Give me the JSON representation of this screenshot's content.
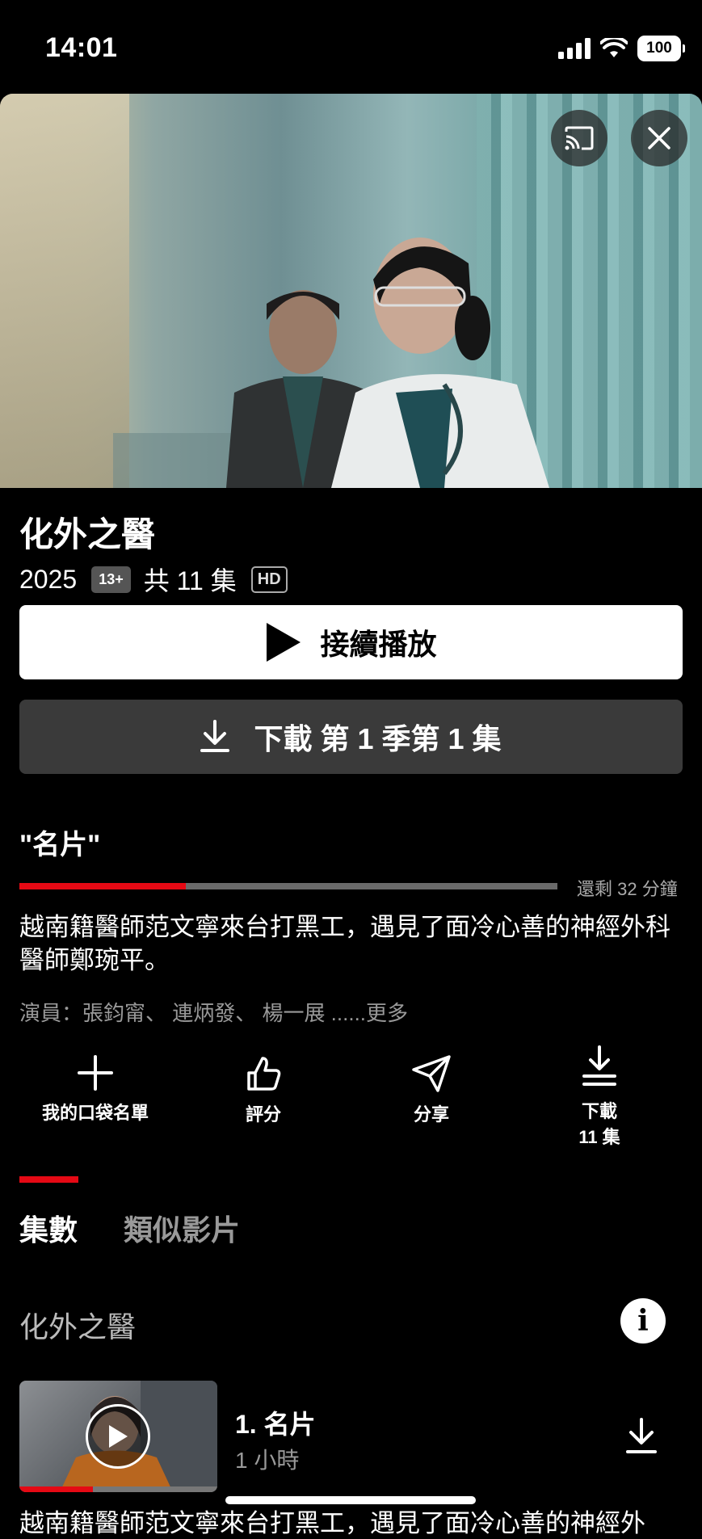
{
  "status_bar": {
    "time": "14:01",
    "battery": "100"
  },
  "hero": {
    "cast_icon": "cast-icon",
    "close_icon": "close-icon"
  },
  "show": {
    "title": "化外之醫",
    "year": "2025",
    "rating": "13+",
    "episodes_count": "共 11 集",
    "quality": "HD"
  },
  "buttons": {
    "resume": "接續播放",
    "download": "下載 第 1 季第 1 集"
  },
  "current_episode": {
    "title": "\"名片\"",
    "progress_fraction": 0.31,
    "remaining": "還剩 32 分鐘",
    "description": "越南籍醫師范文寧來台打黑工，遇見了面冷心善的神經外科醫師鄭琬平。",
    "cast": "演員：張鈞甯、 連炳發、 楊一展 ......更多"
  },
  "actions": {
    "my_list": "我的口袋名單",
    "rate": "評分",
    "share": "分享",
    "download_line1": "下載",
    "download_line2": "11 集"
  },
  "tabs": {
    "episodes": "集數",
    "similar": "類似影片"
  },
  "season": {
    "title": "化外之醫",
    "info_icon": "info-icon"
  },
  "episode_list": [
    {
      "title": "1. 名片",
      "duration": "1 小時",
      "progress_fraction": 0.37
    }
  ],
  "next_description_partial": "越南籍醫師范文寧來台打黑工，遇見了面冷心善的神經外",
  "colors": {
    "accent": "#e50914",
    "background": "#000000",
    "secondary_button": "#3a3a3a"
  }
}
